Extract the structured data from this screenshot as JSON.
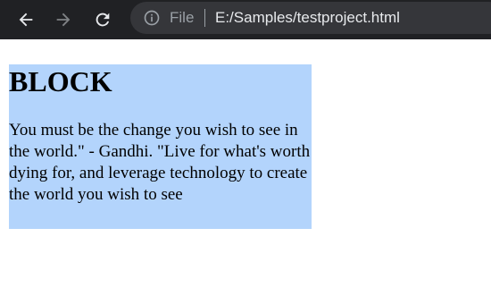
{
  "browser": {
    "toolbar": {
      "back_icon": "arrow-left-icon",
      "forward_icon": "arrow-right-icon",
      "reload_icon": "reload-icon"
    },
    "address_bar": {
      "info_icon": "info-icon",
      "scheme_label": "File",
      "url": "E:/Samples/testproject.html"
    }
  },
  "page": {
    "heading": "BLOCK",
    "paragraph": "You must be the change you wish to see in the world.\" - Gandhi. \"Live for what's worth dying for, and leverage technology to create the world you wish to see",
    "block_background": "#b3d4fc"
  }
}
